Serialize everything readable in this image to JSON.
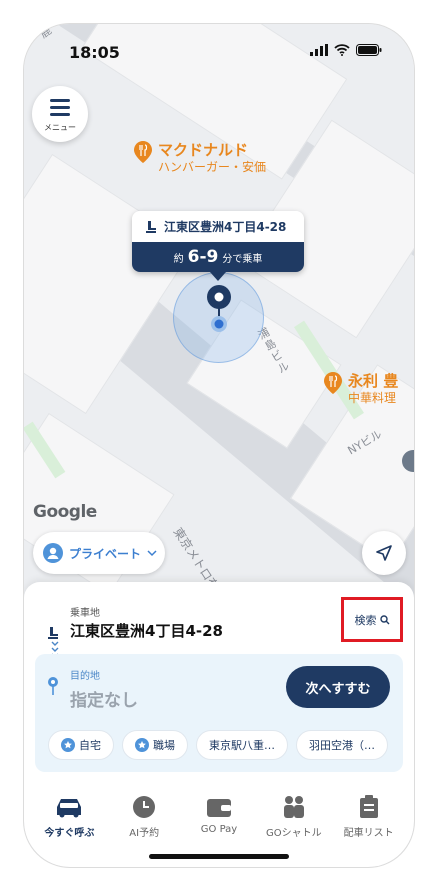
{
  "status": {
    "time": "18:05"
  },
  "menu": {
    "label": "メニュー"
  },
  "map": {
    "poi_main": {
      "name": "マクドナルド",
      "sub": "ハンバーガー・安価"
    },
    "poi_side": {
      "name": "永利 豊",
      "sub": "中華料理"
    },
    "labels": {
      "street1": "浦島ビル",
      "street2": "NYビル",
      "line": "東京メトロ有楽町",
      "top": "鹿"
    },
    "pickup_bubble": {
      "address": "江東区豊洲4丁目4-28",
      "eta_prefix": "約",
      "eta_range": "6-9",
      "eta_suffix": "分で乗車"
    },
    "google": "Google"
  },
  "ride_type": {
    "label": "プライベート"
  },
  "sheet": {
    "pickup_caption": "乗車地",
    "pickup_address": "江東区豊洲4丁目4-28",
    "search_label": "検索",
    "dest_caption": "目的地",
    "dest_value": "指定なし",
    "next_label": "次へすすむ",
    "chips": [
      "自宅",
      "職場",
      "東京駅八重…",
      "羽田空港（…"
    ]
  },
  "tabs": [
    "今すぐ呼ぶ",
    "AI予約",
    "GO Pay",
    "GOシャトル",
    "配車リスト"
  ],
  "colors": {
    "navy": "#1f3a63",
    "accent_orange": "#e8871f",
    "highlight_red": "#e01b24",
    "link_blue": "#3c7fd0"
  }
}
